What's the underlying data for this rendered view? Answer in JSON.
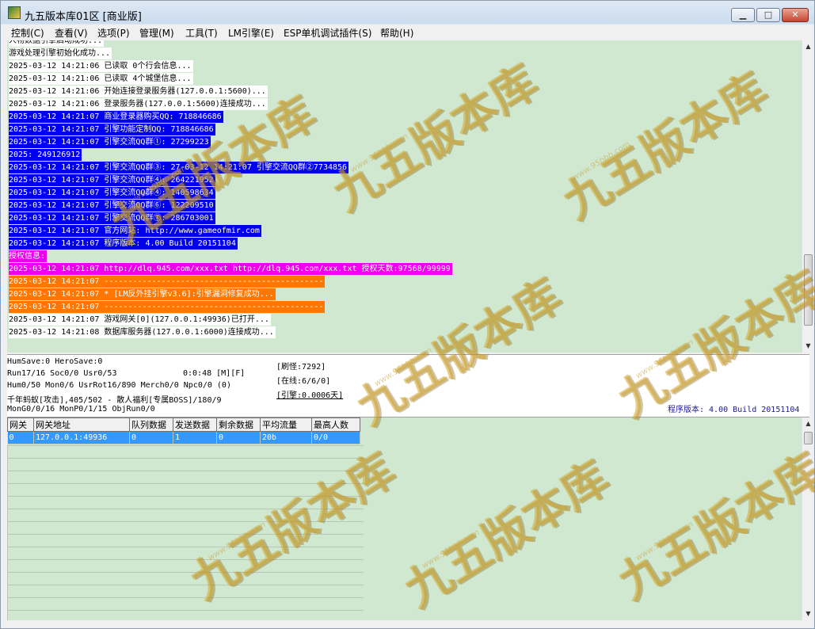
{
  "window": {
    "title": "九五版本库01区 [商业版]",
    "controls": {
      "minimize": "▁",
      "maximize": "□",
      "close": "✕"
    }
  },
  "menu": [
    "控制(C)",
    "查看(V)",
    "选项(P)",
    "管理(M)",
    "工具(T)",
    "LM引擎(E)",
    "ESP单机调试插件(S)",
    "帮助(H)"
  ],
  "log": [
    {
      "text": "人物数据引擎启动成功...",
      "bg": "#ffffff",
      "fg": "#000000"
    },
    {
      "text": "游戏处理引擎初始化成功...",
      "bg": "#ffffff",
      "fg": "#000000"
    },
    {
      "text": "2025-03-12 14:21:06 已读取 0个行会信息...",
      "bg": "#ffffff",
      "fg": "#000000"
    },
    {
      "text": "2025-03-12 14:21:06 已读取 4个城堡信息...",
      "bg": "#ffffff",
      "fg": "#000000"
    },
    {
      "text": "2025-03-12 14:21:06 开始连接登录服务器(127.0.0.1:5600)...",
      "bg": "#ffffff",
      "fg": "#000000"
    },
    {
      "text": "2025-03-12 14:21:06 登录服务器(127.0.0.1:5600)连接成功...",
      "bg": "#ffffff",
      "fg": "#000000"
    },
    {
      "text": "2025-03-12 14:21:07 商业登录器购买QQ: 718846686",
      "bg": "#0000ee",
      "fg": "#ffffff"
    },
    {
      "text": "2025-03-12 14:21:07 引擎功能定制QQ: 718846686",
      "bg": "#0000ee",
      "fg": "#ffffff"
    },
    {
      "text": "2025-03-12 14:21:07 引擎交流QQ群①: 27299223",
      "bg": "#0000ee",
      "fg": "#ffffff"
    },
    {
      "text": "2025: 249126912",
      "bg": "#0000ee",
      "fg": "#ffffff"
    },
    {
      "text": "2025-03-12 14:21:07 引擎交流QQ群③: 27-03-12 14:21:07 引擎交流QQ群②7734856",
      "bg": "#0000ee",
      "fg": "#ffffff"
    },
    {
      "text": "2025-03-12 14:21:07 引擎交流QQ群④: 264221952",
      "bg": "#0000ee",
      "fg": "#ffffff"
    },
    {
      "text": "2025-03-12 14:21:07 引擎交流QQ群④: 140598634",
      "bg": "#0000ee",
      "fg": "#ffffff"
    },
    {
      "text": "2025-03-12 14:21:07 引擎交流QQ群⑥: 122209510",
      "bg": "#0000ee",
      "fg": "#ffffff"
    },
    {
      "text": "2025-03-12 14:21:07 引擎交流QQ群⑦: 286703001",
      "bg": "#0000ee",
      "fg": "#ffffff"
    },
    {
      "text": "2025-03-12 14:21:07 官方网站: http://www.gameofmir.com",
      "bg": "#0000ee",
      "fg": "#ffffff"
    },
    {
      "text": "2025-03-12 14:21:07 程序版本: 4.00 Build 20151104",
      "bg": "#0000ee",
      "fg": "#ffffff"
    },
    {
      "text": "授权信息:",
      "bg": "#ee00ee",
      "fg": "#ffffff"
    },
    {
      "text": "2025-03-12 14:21:07 http://dlq.945.com/xxx.txt http://dlq.945.com/xxx.txt 授权天数:97568/99999",
      "bg": "#ee00ee",
      "fg": "#ffffff"
    },
    {
      "text": "2025-03-12 14:21:07 ----------------------------------------------",
      "bg": "#ff7700",
      "fg": "#ffffff"
    },
    {
      "text": "2025-03-12 14:21:07 * [LM反外挂引擎v3.6]:引擎漏洞修复成功...",
      "bg": "#ff7700",
      "fg": "#ffffff"
    },
    {
      "text": "2025-03-12 14:21:07 ----------------------------------------------",
      "bg": "#ff7700",
      "fg": "#ffffff"
    },
    {
      "text": "2025-03-12 14:21:07 游戏网关[0](127.0.0.1:49936)已打开...",
      "bg": "#ffffff",
      "fg": "#000000"
    },
    {
      "text": "2025-03-12 14:21:08 数据库服务器(127.0.0.1:6000)连接成功...",
      "bg": "#ffffff",
      "fg": "#000000"
    }
  ],
  "status": {
    "line1": "HumSave:0 HeroSave:0",
    "line2": "Run17/16 Soc0/0 Usr0/53",
    "line2_timer": "0:0:48 [M][F]",
    "line3": "Hum0/50 Mon0/6 UsrRot16/890 Merch0/0 Npc0/0 (0)",
    "line4": "千年蚂蚁[攻击],405/502 - 散人福利[专属BOSS]/180/9",
    "line5": "MonG0/0/16 MonP0/1/15 ObjRun0/0",
    "refresh": "[刷怪:7292]",
    "online": "[在线:6/6/0]",
    "engine": "[引擎:0.0006天]",
    "version": "程序版本: 4.00 Build 20151104"
  },
  "gate_table": {
    "headers": [
      "网关",
      "网关地址",
      "队列数据",
      "发送数据",
      "剩余数据",
      "平均流量",
      "最高人数"
    ],
    "rows": [
      [
        "0",
        "127.0.0.1:49936",
        "0",
        "1",
        "0",
        "20b",
        "0/0"
      ]
    ]
  },
  "watermark": {
    "text": "九五版本库",
    "url": "www.95bbb.com"
  }
}
